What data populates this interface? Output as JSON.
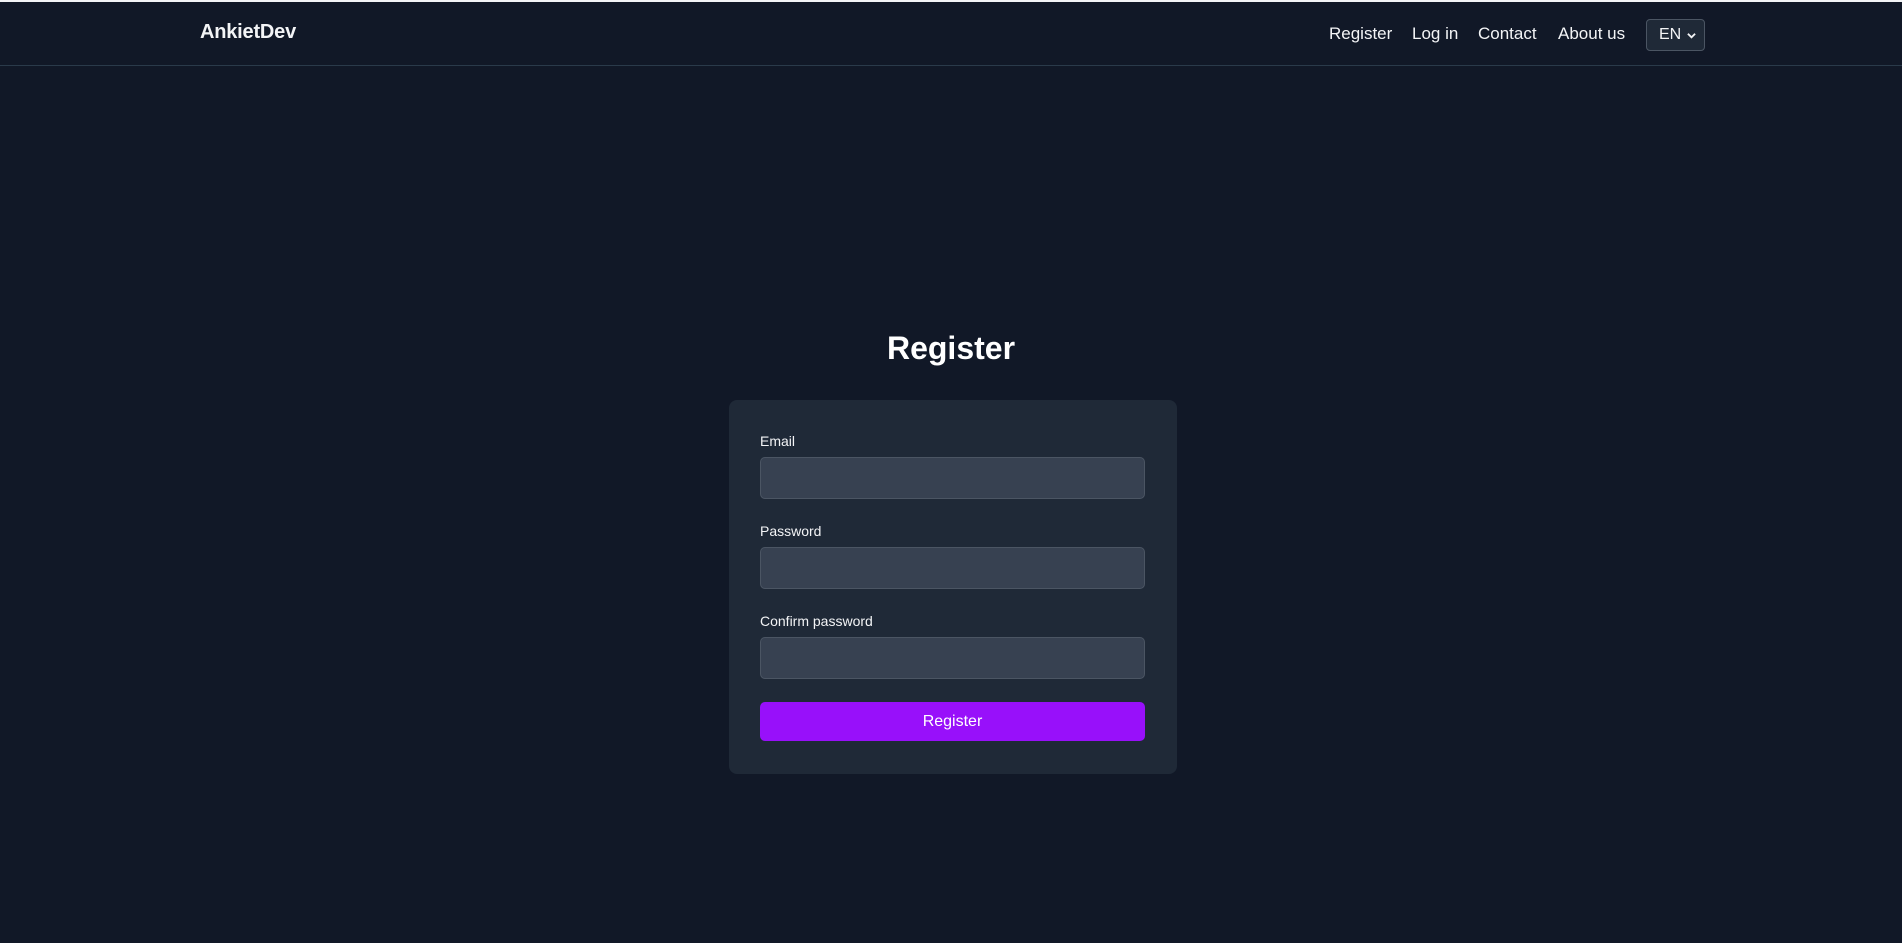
{
  "brand": "AnkietDev",
  "nav": {
    "links": [
      "Register",
      "Log in",
      "Contact",
      "About us"
    ],
    "language": "EN"
  },
  "form": {
    "title": "Register",
    "email_label": "Email",
    "email_value": "",
    "password_label": "Password",
    "password_value": "",
    "confirm_label": "Confirm password",
    "confirm_value": "",
    "submit_label": "Register"
  },
  "colors": {
    "background": "#111827",
    "card": "#1f2937",
    "input": "#374151",
    "accent": "#9810fa"
  },
  "icons": {
    "language_dropdown": "chevron-down-icon"
  }
}
